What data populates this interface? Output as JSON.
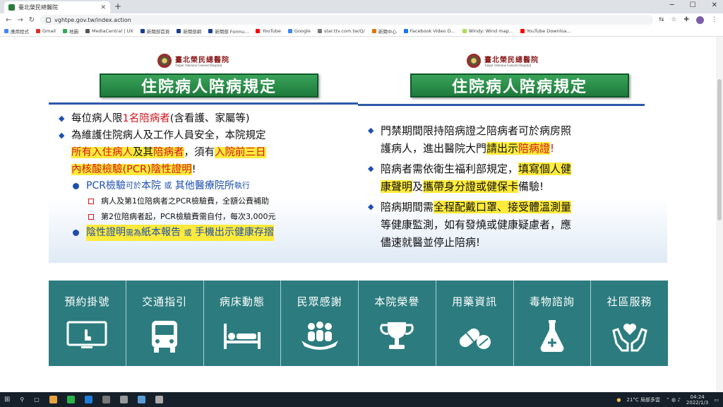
{
  "browser": {
    "tab_title": "臺北榮民總醫院",
    "url": "vghtpe.gov.tw/index.action",
    "bookmarks": [
      "應用程式",
      "Gmail",
      "地圖",
      "MediaCentral | UX",
      "新聞部首頁",
      "新聞部網",
      "新聞部 Formu...",
      "YouTube",
      "Google",
      "star.ttv.com.tw/Q/",
      "新聞中心",
      "Facebook Video D...",
      "Windy: Wind map...",
      "YouTube Downloa..."
    ]
  },
  "left_panel": {
    "logo_cn": "臺北榮民總醫院",
    "logo_en": "Taipei Veterans General Hospital",
    "title": "住院病人陪病規定",
    "b1_a": "每位病人限",
    "b1_red": "1名陪病者",
    "b1_b": "(含看護、家屬等)",
    "b2_a": "為維護住院病人及工作人員安全，本院規定",
    "b2_hl1": "所有入住",
    "b2_hl1r": "病人",
    "b2_hl1b": "及其",
    "b2_hl1c": "陪病者",
    "b2_b": "，須有",
    "b2_red": "入院前三日",
    "b2_hl2": "內核酸檢驗(PCR)陰性證明",
    "b2_end": "!",
    "s1_a": "PCR檢驗",
    "s1_b": "可於",
    "s1_c": "本院",
    "s1_d": "或",
    "s1_e": "其他醫療院所",
    "s1_f": "執行",
    "ss1": "病人及第1位陪病者之PCR檢驗費，全額公費補助",
    "ss2": "第2位陪病者起，PCR檢驗費需自付，每次3,000元",
    "s2_a": "陰性證明",
    "s2_b": "需為",
    "s2_c": "紙本報告",
    "s2_d": "或",
    "s2_e": "手機出示健康存摺"
  },
  "right_panel": {
    "logo_cn": "臺北榮民總醫院",
    "logo_en": "Taipei Veterans General Hospital",
    "title": "住院病人陪病規定",
    "b1_l1": "門禁期間限持陪病證之陪病者可於病房照",
    "b1_l2a": "護病人，進出醫院大門",
    "b1_l2hl": "請出示",
    "b1_l2red": "陪病證",
    "b1_l2end": "!",
    "b2_l1a": "陪病者需依衛生福利部規定，",
    "b2_l1hl": "填寫個人健",
    "b2_l2hl": "康聲明",
    "b2_l2a": "及",
    "b2_l2hl2": "攜帶身分證或健保卡",
    "b2_l2end": "備驗!",
    "b3_l1a": "陪病期間需",
    "b3_l1hl": "全程配戴口罩、接受體溫測量",
    "b3_l2": "等健康監測，如有發燒或健康疑慮者，應",
    "b3_l3": "儘速就醫並停止陪病!"
  },
  "menu": [
    {
      "label": "預約掛號",
      "icon": "monitor-hand-icon"
    },
    {
      "label": "交通指引",
      "icon": "bus-icon"
    },
    {
      "label": "病床動態",
      "icon": "hospital-bed-icon"
    },
    {
      "label": "民眾感謝",
      "icon": "people-hands-icon"
    },
    {
      "label": "本院榮譽",
      "icon": "trophy-icon"
    },
    {
      "label": "用藥資訊",
      "icon": "pills-icon"
    },
    {
      "label": "毒物諮詢",
      "icon": "flask-icon"
    },
    {
      "label": "社區服務",
      "icon": "heart-hands-icon"
    }
  ],
  "taskbar": {
    "weather": "21°C 局部多雲",
    "time": "04:24",
    "date": "2022/1/3"
  }
}
